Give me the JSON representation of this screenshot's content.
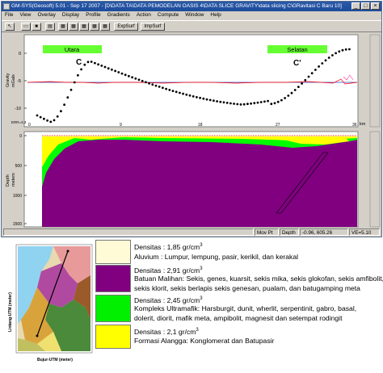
{
  "window": {
    "title": "GM-SYS(Geosoft) 5.01 - Sep 17 2007 - [D\\DATA TA\\DATA PEMODELAN OASIS 4\\DATA SLICE GRAVITY\\data slicing C\\GRavitasi C Baru 10]",
    "min_glyph": "_",
    "max_glyph": "□",
    "close_glyph": "×"
  },
  "menu": [
    "File",
    "View",
    "Overlay",
    "Display",
    "Profile",
    "Gradients",
    "Action",
    "Compute",
    "Window",
    "Help"
  ],
  "toolbar": {
    "expsurf_label": "ExpSurf",
    "impsurf_label": "ImpSurf"
  },
  "gravity_panel": {
    "ylabel_line1": "Gravity",
    "ylabel_line2": "mGals",
    "yticks": [
      "0",
      "-5",
      "-10"
    ],
    "label_north": "Utara",
    "label_south": "Selatan",
    "point_c": "C",
    "point_c_prime": "C'",
    "error_label": "ERR=4.3",
    "xticks": [
      "0",
      "9",
      "18",
      "27",
      "36"
    ],
    "xunit": "km"
  },
  "depth_panel": {
    "ylabel_line1": "Depth",
    "ylabel_line2": "meters",
    "yticks": [
      "0",
      "500",
      "1000",
      "1500"
    ]
  },
  "status": {
    "mode": "Mov Pt",
    "field": "Depth",
    "coords": "-0.96, 605.26",
    "ve": "VE=5.10"
  },
  "map": {
    "ylabel": "Lintang-UTM (meter)",
    "xlabel": "Bujur-UTM (meter)"
  },
  "legend": [
    {
      "color": "#fffbd6",
      "density_prefix": "Densitas : 1,85 gr/cm",
      "density_sup": "3",
      "desc": [
        "Aluvium : Lumpur, lempung, pasir, kerikil, dan kerakal"
      ]
    },
    {
      "color": "#800080",
      "density_prefix": "Densitas : 2,91 gr/cm",
      "density_sup": "3",
      "desc": [
        "Batuan Malihan: Sekis, genes, kuarsit, sekis mika, sekis glokofan, sekis amfibolit,",
        "sekis klorit, sekis berlapis sekis genesan, pualam, dan batugamping meta"
      ]
    },
    {
      "color": "#00f000",
      "density_prefix": "Densitas : 2,45 gr/cm",
      "density_sup": "3",
      "desc": [
        "Kompleks Ultramafik: Harsburgit, dunit, wherlit, serpentinit, gabro, basal,",
        "dolerit, diorit, mafik meta, ampibolit, magnesit dan setempat rodingit"
      ]
    },
    {
      "color": "#ffff00",
      "density_prefix": "Densitas : 2,1 gr/cm",
      "density_sup": "3",
      "desc": [
        "Formasi Alangga: Konglomerat dan Batupasir"
      ]
    }
  ],
  "colors": {
    "titlebar": "#1d4b9c",
    "chrome": "#d4d0c8",
    "panel_bg": "#ffffff",
    "observed_line": "#ff0000",
    "calculated_points": "#000000",
    "label_bg": "#66ff33"
  }
}
